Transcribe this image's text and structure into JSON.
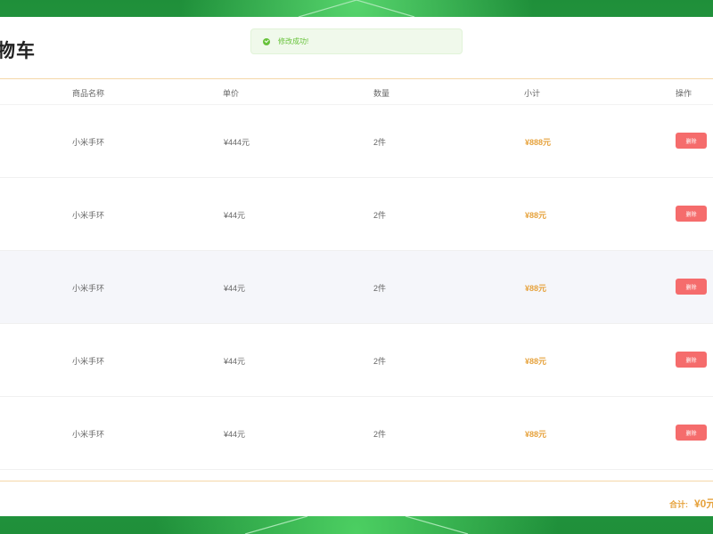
{
  "page": {
    "title": "物车"
  },
  "toast": {
    "icon": "success-check-icon",
    "message": "修改成功!",
    "color": "#67c23a"
  },
  "table": {
    "columns": [
      "商品名称",
      "单价",
      "数量",
      "小计",
      "操作"
    ],
    "rows": [
      {
        "name": "小米手环",
        "price": "¥444元",
        "qty": "2件",
        "subtotal": "¥888元",
        "action": "删除"
      },
      {
        "name": "小米手环",
        "price": "¥44元",
        "qty": "2件",
        "subtotal": "¥88元",
        "action": "删除"
      },
      {
        "name": "小米手环",
        "price": "¥44元",
        "qty": "2件",
        "subtotal": "¥88元",
        "action": "删除"
      },
      {
        "name": "小米手环",
        "price": "¥44元",
        "qty": "2件",
        "subtotal": "¥88元",
        "action": "删除"
      },
      {
        "name": "小米手环",
        "price": "¥44元",
        "qty": "2件",
        "subtotal": "¥88元",
        "action": "删除"
      }
    ]
  },
  "footer": {
    "total_label": "合计:",
    "total_value": "¥0元"
  },
  "colors": {
    "accent": "#e6a23c",
    "danger": "#f56c6c",
    "background": "#2ea84a"
  }
}
